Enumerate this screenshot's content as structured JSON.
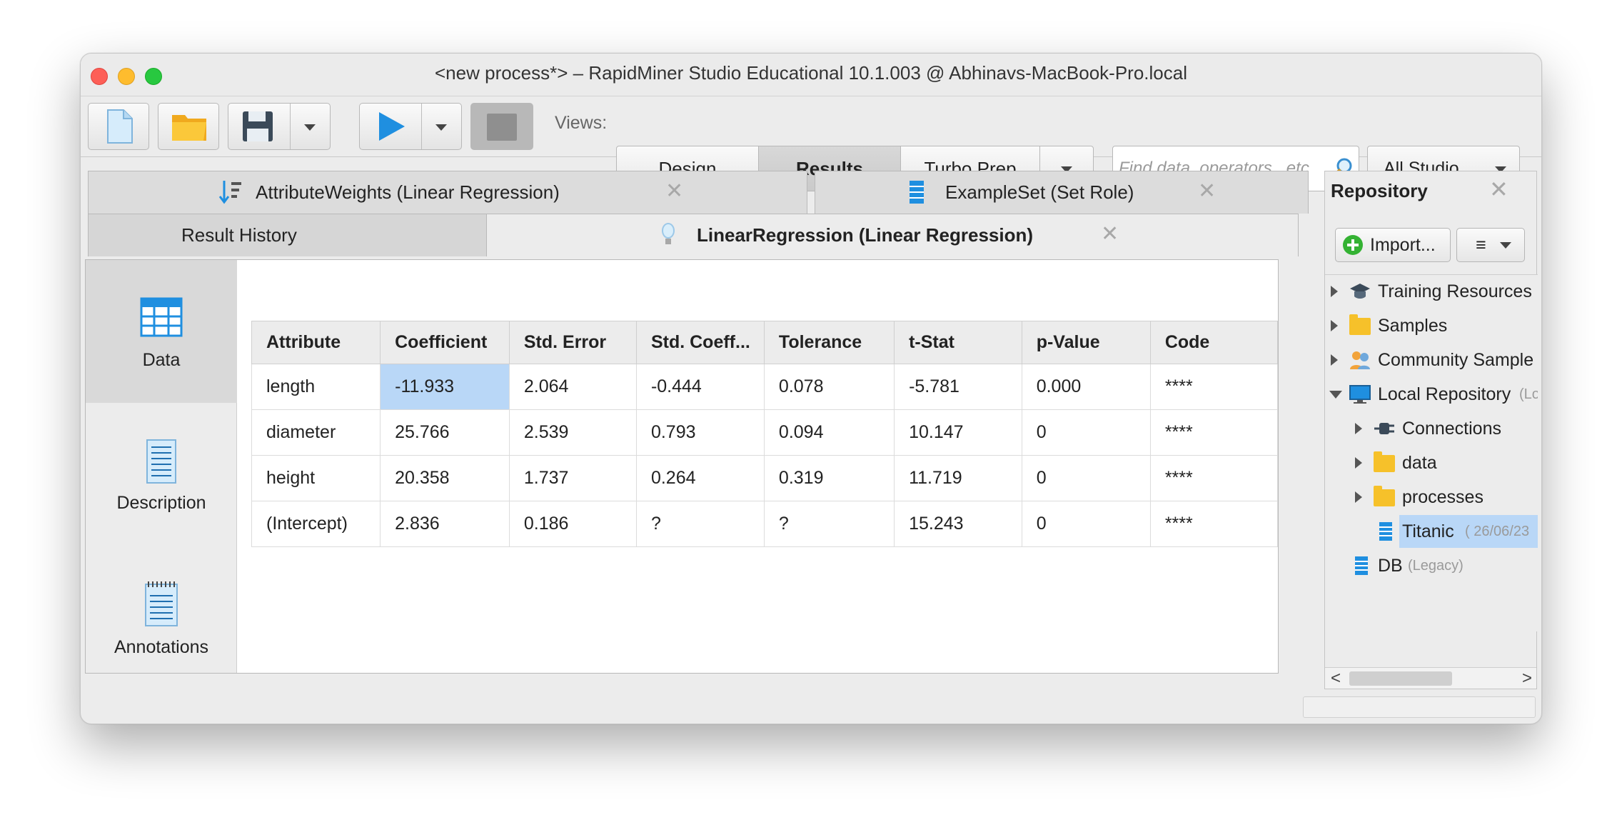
{
  "window": {
    "title": "<new process*> – RapidMiner Studio Educational 10.1.003 @ Abhinavs-MacBook-Pro.local"
  },
  "toolbar": {
    "views_label": "Views:",
    "views": [
      "Design",
      "Results",
      "Turbo Prep"
    ],
    "active_view": "Results",
    "search_placeholder": "Find data, operators...etc",
    "scope": "All Studio"
  },
  "tabs": {
    "top": [
      {
        "label": "AttributeWeights (Linear Regression)"
      },
      {
        "label": "ExampleSet (Set Role)"
      }
    ],
    "bottom": [
      {
        "label": "Result History"
      },
      {
        "label": "LinearRegression (Linear Regression)"
      }
    ]
  },
  "sidenav": [
    "Data",
    "Description",
    "Annotations"
  ],
  "table": {
    "headers": [
      "Attribute",
      "Coefficient",
      "Std. Error",
      "Std. Coeff...",
      "Tolerance",
      "t-Stat",
      "p-Value",
      "Code"
    ],
    "rows": [
      [
        "length",
        "-11.933",
        "2.064",
        "-0.444",
        "0.078",
        "-5.781",
        "0.000",
        "****"
      ],
      [
        "diameter",
        "25.766",
        "2.539",
        "0.793",
        "0.094",
        "10.147",
        "0",
        "****"
      ],
      [
        "height",
        "20.358",
        "1.737",
        "0.264",
        "0.319",
        "11.719",
        "0",
        "****"
      ],
      [
        "(Intercept)",
        "2.836",
        "0.186",
        "?",
        "?",
        "15.243",
        "0",
        "****"
      ]
    ]
  },
  "repository": {
    "title": "Repository",
    "import_label": "Import...",
    "menu_label": "≡",
    "tree": [
      {
        "label": "Training Resources"
      },
      {
        "label": "Samples"
      },
      {
        "label": "Community Sample"
      },
      {
        "label": "Local Repository",
        "hint": "(Lo"
      },
      {
        "label": "Connections"
      },
      {
        "label": "data"
      },
      {
        "label": "processes"
      },
      {
        "label": "Titanic",
        "hint": "( 26/06/23"
      },
      {
        "label": "DB",
        "hint": "(Legacy)"
      }
    ]
  },
  "colors": {
    "selected_cell": "#b9d7f7",
    "play": "#1f8fe0",
    "folder": "#f6c12a",
    "close": "#fd5f57",
    "minimize": "#febc2e",
    "zoom": "#28c840"
  }
}
